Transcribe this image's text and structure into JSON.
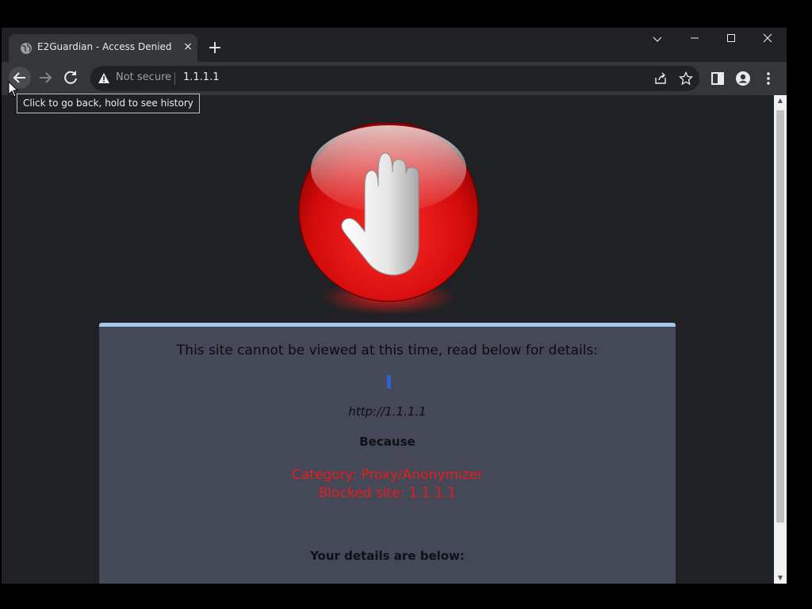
{
  "browser": {
    "tab_title": "E2Guardian - Access Denied",
    "tab_close": "×",
    "new_tab": "+",
    "security_label": "Not secure",
    "address": "1.1.1.1",
    "tooltip": "Click to go back, hold to see history"
  },
  "icons": {
    "favicon": "globe-icon",
    "back": "arrow-left-icon",
    "forward": "arrow-right-icon",
    "reload": "reload-icon",
    "warning": "warning-triangle-icon",
    "share": "share-icon",
    "bookmark": "star-icon",
    "side_panel": "side-panel-icon",
    "profile": "profile-icon",
    "menu": "kebab-menu-icon",
    "stop": "stop-hand-icon"
  },
  "page": {
    "heading": "This site cannot be viewed at this time, read below for details:",
    "blocked_url": "http://1.1.1.1",
    "because": "Because",
    "reason_category": "Category: Proxy/Anonymizer",
    "reason_site": "Blocked site: 1.1.1.1",
    "details_heading": "Your details are below:"
  },
  "colors": {
    "panel_bg": "#444857",
    "panel_accent": "#a4c8ec",
    "reason_text": "#e81d1d",
    "page_bg": "#202124"
  }
}
